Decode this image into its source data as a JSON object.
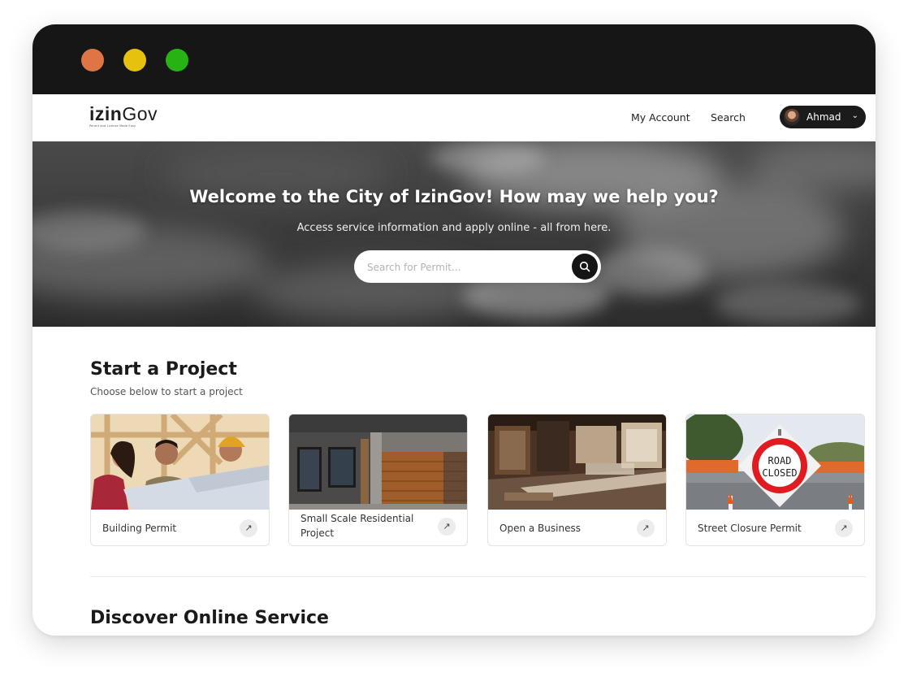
{
  "window": {
    "controls": [
      "close",
      "minimize",
      "maximize"
    ],
    "colors": {
      "close": "#df7446",
      "minimize": "#e6c20f",
      "maximize": "#27b314",
      "titlebar": "#161616"
    }
  },
  "header": {
    "logo_bold": "izin",
    "logo_light": "Gov",
    "logo_tagline": "Permit and License Made Easy",
    "nav": {
      "account": "My Account",
      "search": "Search"
    },
    "user": {
      "name": "Ahmad"
    }
  },
  "hero": {
    "title": "Welcome to the City of IzinGov! How may we help you?",
    "subtitle": "Access service information and apply online - all from here.",
    "search_placeholder": "Search for Permit..."
  },
  "projects": {
    "title": "Start a Project",
    "subtitle": "Choose below to start a project",
    "cards": [
      {
        "label": "Building Permit",
        "image": "construction-workers-image"
      },
      {
        "label": "Small Scale Residential Project",
        "image": "house-garage-image"
      },
      {
        "label": "Open a Business",
        "image": "cafe-interior-image"
      },
      {
        "label": "Street Closure Permit",
        "image": "road-closed-sign-image"
      }
    ],
    "sign_text": [
      "ROAD",
      "CLOSED"
    ]
  },
  "discover": {
    "title": "Discover Online Service"
  }
}
